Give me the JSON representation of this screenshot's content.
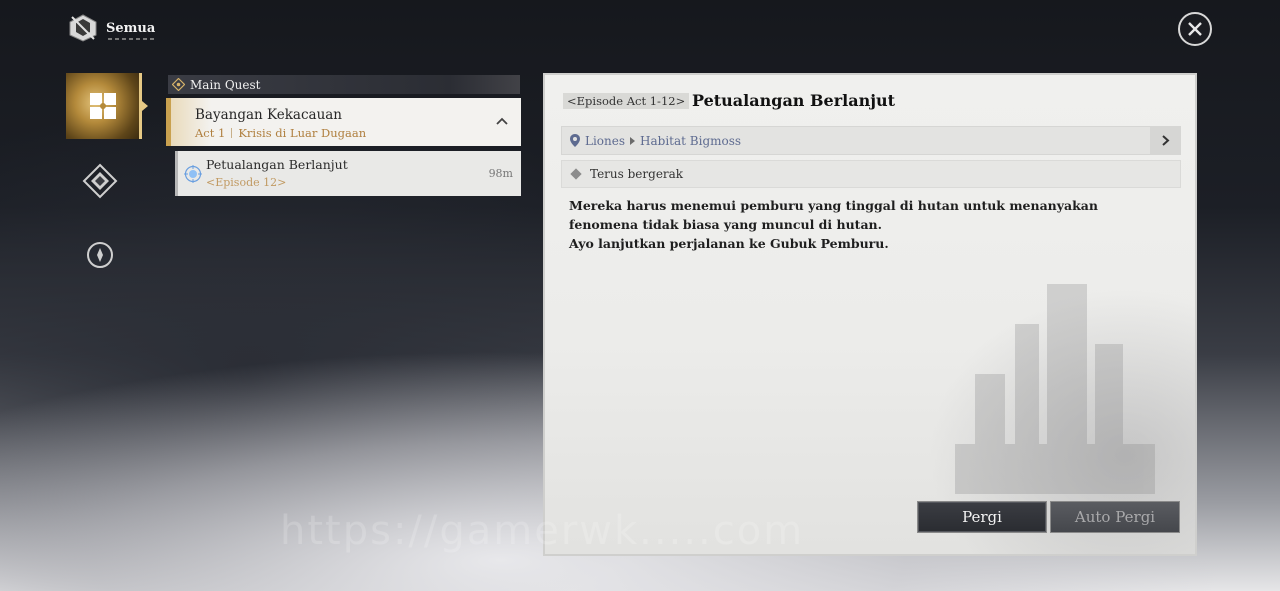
{
  "header": {
    "title": "Semua",
    "close_icon": "close-icon"
  },
  "nav": {
    "items": [
      {
        "icon": "quest-grid-icon",
        "active": true
      },
      {
        "icon": "diamond-compass-icon",
        "active": false
      },
      {
        "icon": "compass-circle-icon",
        "active": false
      }
    ]
  },
  "quest_list": {
    "section_label": "Main Quest",
    "group": {
      "title": "Bayangan Kekacauan",
      "act": "Act 1",
      "act_name": "Krisis di Luar Dugaan",
      "expanded": true
    },
    "items": [
      {
        "title": "Petualangan Berlanjut",
        "episode": "<Episode 12>",
        "distance": "98m",
        "selected": true
      }
    ]
  },
  "detail": {
    "episode_badge": "<Episode Act 1-12>",
    "title": "Petualangan Berlanjut",
    "location": {
      "region": "Liones",
      "area": "Habitat Bigmoss"
    },
    "objective": "Terus bergerak",
    "description": [
      "Mereka harus menemui pemburu yang tinggal di hutan untuk menanyakan fenomena tidak biasa yang muncul di hutan.",
      "Ayo lanjutkan perjalanan ke Gubuk Pemburu."
    ],
    "buttons": {
      "go": "Pergi",
      "auto_go": "Auto Pergi"
    }
  },
  "watermark": "https://gamerwk.....com",
  "colors": {
    "gold_accent": "#c9a14f",
    "panel_bg": "#ececea",
    "location_text": "#5e6b90",
    "episode_text": "#c19a62"
  }
}
